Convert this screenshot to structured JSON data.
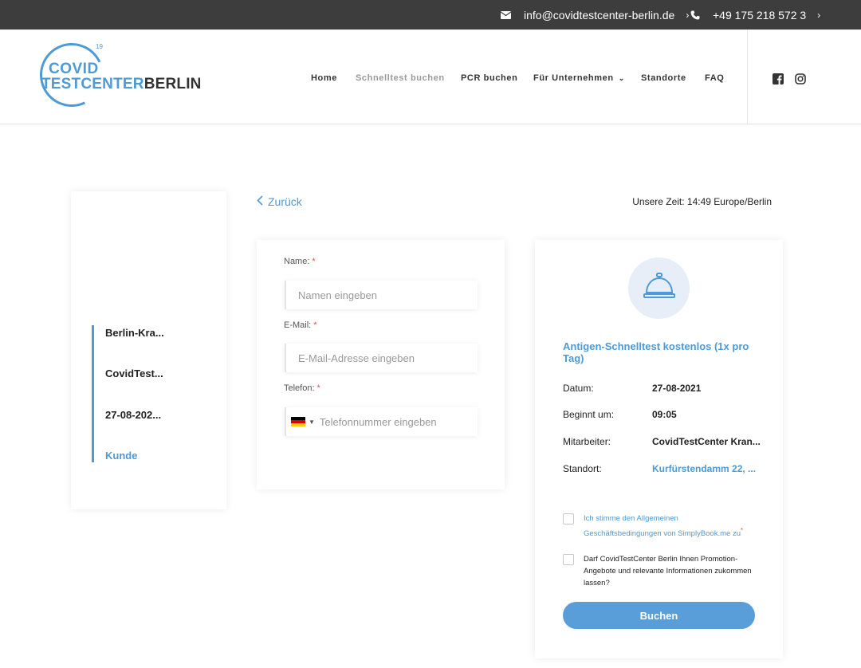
{
  "topbar": {
    "email": "info@covidtestcenter-berlin.de",
    "phone": "+49 175 218 572 3",
    "icons": [
      "envelope-icon",
      "phone-icon",
      "chevron-right-icon"
    ]
  },
  "header": {
    "logo": {
      "sup": "19",
      "line1": "COVID",
      "line2_blue": "TESTCENTER",
      "line2_dark": "BERLIN"
    },
    "nav": [
      {
        "label": "Home"
      },
      {
        "label": "Schnelltest buchen"
      },
      {
        "label": "PCR buchen"
      },
      {
        "label": "Für Unternehmen"
      },
      {
        "label": "Standorte"
      },
      {
        "label": "FAQ"
      }
    ],
    "social_icons": [
      "facebook-icon",
      "instagram-icon"
    ]
  },
  "sidebar": {
    "steps": [
      {
        "label": "Berlin-Kra..."
      },
      {
        "label": "CovidTest..."
      },
      {
        "label": "27-08-202..."
      },
      {
        "label": "Kunde"
      }
    ]
  },
  "booking": {
    "back_label": "Zurück",
    "timezone": "Unsere Zeit: 14:49 Europe/Berlin",
    "form": {
      "name_label": "Name:",
      "name_placeholder": "Namen eingeben",
      "email_label": "E-Mail:",
      "email_placeholder": "E-Mail-Adresse eingeben",
      "phone_label": "Telefon:",
      "phone_placeholder": "Telefonnummer eingeben",
      "required_mark": "*"
    },
    "summary": {
      "service_icon": "service-bell-icon",
      "service_title": "Antigen-Schnelltest kostenlos (1x pro Tag)",
      "rows": [
        {
          "label": "Datum:",
          "value": "27-08-2021"
        },
        {
          "label": "Beginnt um:",
          "value": "09:05"
        },
        {
          "label": "Mitarbeiter:",
          "value": "CovidTestCenter Kran..."
        },
        {
          "label": "Standort:",
          "value": "Kurfürstendamm 22, ..."
        }
      ],
      "terms_text": "Ich stimme den Allgemeinen Geschäftsbedingungen von SimplyBook.me zu",
      "terms_required": "*",
      "promo_text": "Darf CovidTestCenter Berlin Ihnen Promotion-Angebote und relevante Informationen zukommen lassen?",
      "book_label": "Buchen"
    }
  },
  "colors": {
    "accent": "#4d9ad7",
    "button": "#5a9ed9",
    "topbar": "#3d3d3d",
    "required": "#e05050"
  }
}
